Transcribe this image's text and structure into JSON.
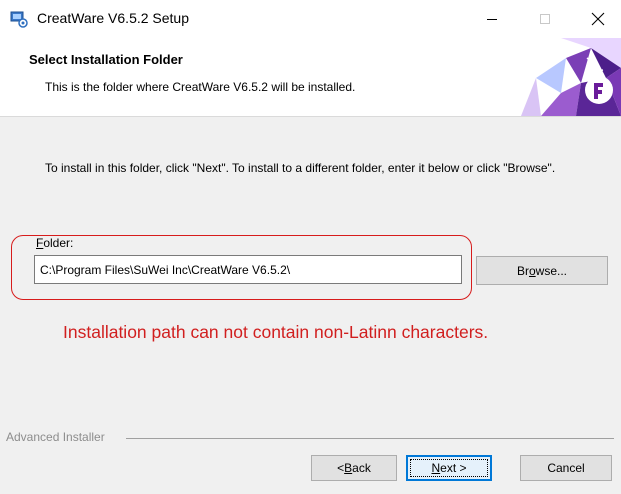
{
  "window": {
    "title": "CreatWare V6.5.2 Setup",
    "app_icon": "installer-icon",
    "controls": [
      "minimize-icon",
      "maximize-icon",
      "close-icon"
    ]
  },
  "header": {
    "title": "Select Installation Folder",
    "subtitle": "This is the folder where CreatWare V6.5.2 will be installed."
  },
  "body": {
    "instructions": "To install in this folder, click \"Next\". To install to a different folder, enter it below or click \"Browse\".",
    "folder_label_mnemonic": "F",
    "folder_label_rest": "older:",
    "folder_value": "C:\\Program Files\\SuWei Inc\\CreatWare V6.5.2\\",
    "browse_pre": "Br",
    "browse_mnemonic": "o",
    "browse_post": "wse...",
    "error_text": "Installation path can not contain non-Latinn characters."
  },
  "footer": {
    "vendor_label": "Advanced Installer",
    "back_pre": "< ",
    "back_mnemonic": "B",
    "back_post": "ack",
    "next_mnemonic": "N",
    "next_post": "ext >",
    "cancel_label": "Cancel"
  },
  "colors": {
    "error": "#d11f1f",
    "focus_border": "#0078d7",
    "banner_accent": "#6a1b9a"
  }
}
